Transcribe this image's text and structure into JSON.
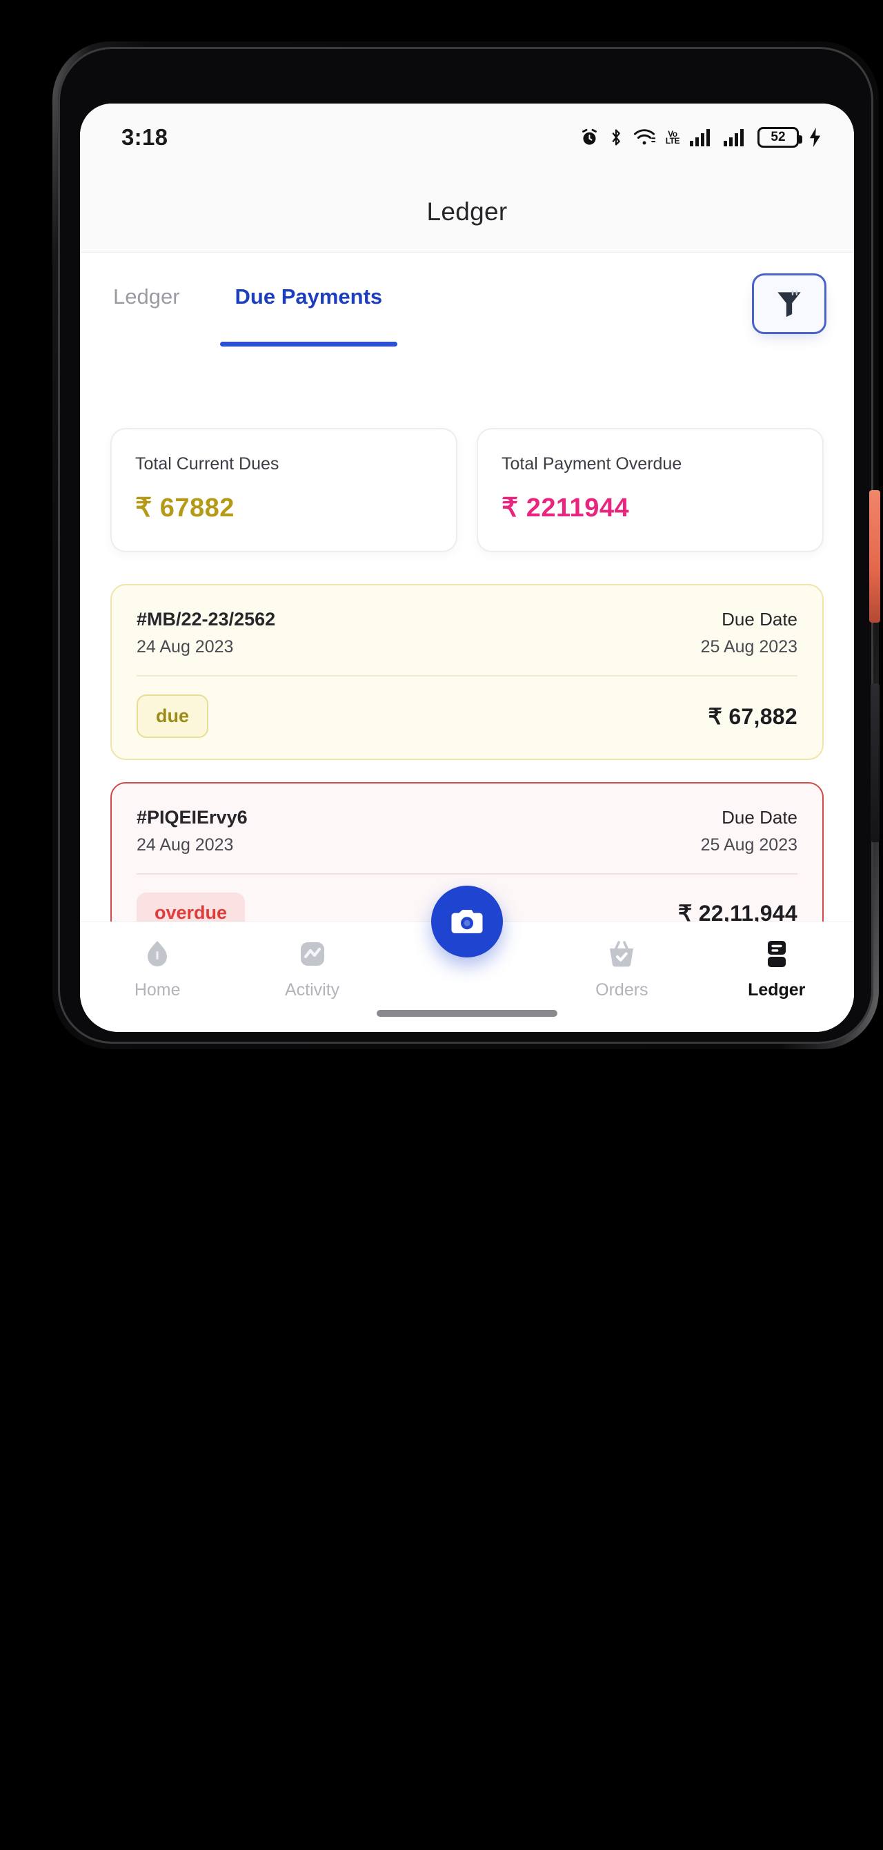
{
  "device": {
    "frame_color": "#0a0a0c",
    "power_button_color": "#e4674b"
  },
  "status_bar": {
    "time": "3:18",
    "battery_level": "52",
    "icons": [
      "alarm-icon",
      "bluetooth-icon",
      "wifi-icon",
      "volte-icon",
      "signal-sim1-icon",
      "signal-sim2-icon",
      "battery-icon",
      "charging-bolt-icon"
    ],
    "volte_line1": "Vo",
    "volte_line2": "LTE"
  },
  "header": {
    "title": "Ledger"
  },
  "tabs": [
    {
      "label": "Ledger",
      "active": false
    },
    {
      "label": "Due Payments",
      "active": true
    }
  ],
  "filter": {
    "icon": "filter-funnel-icon",
    "border_color": "#4a63c9"
  },
  "summary_cards": [
    {
      "label": "Total Current Dues",
      "currency": "₹",
      "amount": "67882",
      "color": "#b59a17"
    },
    {
      "label": "Total Payment Overdue",
      "currency": "₹",
      "amount": "2211944",
      "color": "#e8267f"
    }
  ],
  "payments": [
    {
      "id": "#MB/22-23/2562",
      "issue_date": "24 Aug 2023",
      "due_date_label": "Due Date",
      "due_date": "25 Aug 2023",
      "status": "due",
      "currency": "₹",
      "amount": "67,882",
      "accent": "#efe5a8"
    },
    {
      "id": "#PIQEIErvy6",
      "issue_date": "24 Aug 2023",
      "due_date_label": "Due Date",
      "due_date": "25 Aug 2023",
      "status": "overdue",
      "currency": "₹",
      "amount": "22,11,944",
      "accent": "#d04a4a"
    }
  ],
  "bottom_nav": {
    "items": [
      {
        "label": "Home",
        "icon": "home-icon",
        "active": false
      },
      {
        "label": "Activity",
        "icon": "activity-chart-icon",
        "active": false
      },
      {
        "label": "Orders",
        "icon": "basket-check-icon",
        "active": false
      },
      {
        "label": "Ledger",
        "icon": "ledger-book-icon",
        "active": true
      }
    ],
    "fab": {
      "icon": "camera-icon",
      "color": "#1f44cf"
    }
  }
}
